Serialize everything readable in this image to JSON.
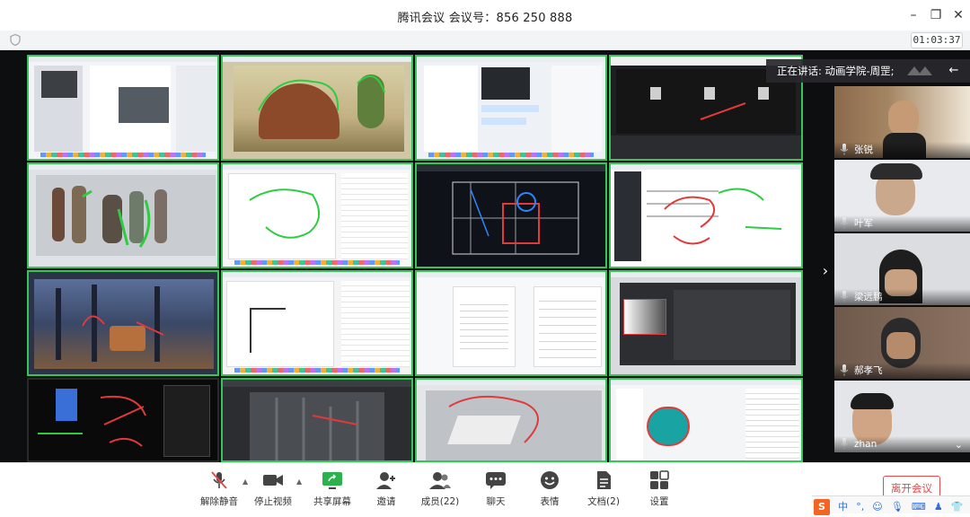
{
  "window": {
    "title": "腾讯会议 会议号：856 250 888",
    "timer": "01:03:37"
  },
  "stage": {
    "speaking_text": "正在讲话: 动画学院-周罡;"
  },
  "participants": [
    {
      "name": "张锐"
    },
    {
      "name": "叶军"
    },
    {
      "name": "梁远鹏"
    },
    {
      "name": "郝孝飞"
    },
    {
      "name": "zhan"
    }
  ],
  "toolbar": {
    "mute_label": "解除静音",
    "video_label": "停止视频",
    "share_label": "共享屏幕",
    "invite_label": "邀请",
    "members_label": "成员(22)",
    "chat_label": "聊天",
    "emoji_label": "表情",
    "docs_label": "文档(2)",
    "settings_label": "设置",
    "leave_label": "离开会议"
  },
  "ime": {
    "lang": "中",
    "punct": "°,"
  },
  "colors": {
    "active_border": "#37c45b",
    "leave_red": "#e24b4b",
    "ime_orange": "#f26522"
  }
}
